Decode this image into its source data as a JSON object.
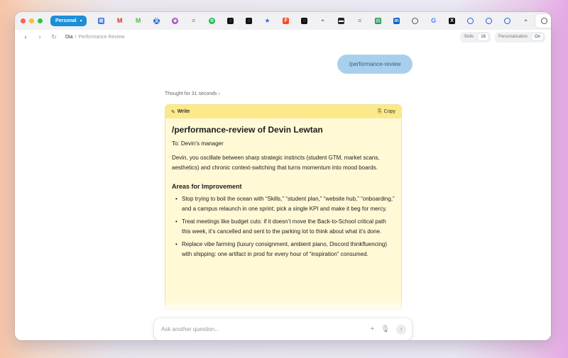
{
  "tabbar": {
    "profile_label": "Personal",
    "tabs": [
      {
        "icon": "calendar-icon",
        "color": "#3b73d9"
      },
      {
        "icon": "gmail-icon",
        "color": "#d93025"
      },
      {
        "icon": "miro-icon",
        "color": "#58b94a"
      },
      {
        "icon": "translate-icon",
        "color": "#2d6fd8"
      },
      {
        "icon": "chrome-icon",
        "color": "#a544c9"
      },
      {
        "icon": "linear-icon",
        "color": "#8b8b8b"
      },
      {
        "icon": "spotify-icon",
        "color": "#1db954"
      },
      {
        "icon": "chatgpt-icon",
        "color": "#111111"
      },
      {
        "icon": "chatgpt-icon",
        "color": "#111111"
      },
      {
        "icon": "star-icon",
        "color": "#3a6ad8"
      },
      {
        "icon": "figma-icon",
        "color": "#f24e1e"
      },
      {
        "icon": "chatgpt-icon",
        "color": "#111111"
      },
      {
        "icon": "game-icon",
        "color": "#7a7a7a"
      },
      {
        "icon": "terminal-icon",
        "color": "#222222"
      },
      {
        "icon": "linear-icon",
        "color": "#8b8b8b"
      },
      {
        "icon": "sheets-icon",
        "color": "#1f9d55"
      },
      {
        "icon": "linkedin-icon",
        "color": "#0a66c2"
      },
      {
        "icon": "chat-bubble-icon",
        "color": "#555555"
      },
      {
        "icon": "google-icon",
        "color": "#4285f4"
      },
      {
        "icon": "x-icon",
        "color": "#111111"
      },
      {
        "icon": "1password-icon",
        "color": "#1a5fd6"
      },
      {
        "icon": "1password-icon",
        "color": "#1a5fd6"
      },
      {
        "icon": "1password-icon",
        "color": "#1a5fd6"
      },
      {
        "icon": "game-icon",
        "color": "#7a7a7a"
      },
      {
        "icon": "chat-bubble-icon",
        "color": "#555555",
        "active": true
      }
    ],
    "new_tab_label": "+"
  },
  "navbar": {
    "site": "Dia",
    "separator": "/",
    "page": "Performance Review",
    "skills_label": "Skills",
    "skills_count": "16",
    "personalization_label": "Personalization",
    "personalization_value": "On"
  },
  "chat": {
    "user_message": "/performance-review",
    "thought_label": "Thought for 31 seconds",
    "card": {
      "write_label": "Write",
      "copy_label": "Copy",
      "title": "/performance-review of Devin Lewtan",
      "to_line": "To: Devin’s manager",
      "intro": "Devin, you oscillate between sharp strategic instincts (student GTM, market scans, aesthetics) and chronic context-switching that turns momentum into mood boards.",
      "section_title": "Areas for Improvement",
      "items": [
        "Stop trying to boil the ocean with “Skills,” “student plan,” “website hub,” “onboarding,” and a campus relaunch in one sprint; pick a single KPI and make it beg for mercy.",
        "Treat meetings like budget cuts: if it doesn’t move the Back-to-School critical path this week, it’s cancelled and sent to the parking lot to think about what it’s done.",
        "Replace vibe farming (luxury consignment, ambient piano, Discord thinkfluencing) with shipping: one artifact in prod for every hour of “inspiration” consumed."
      ]
    },
    "input_placeholder": "Ask another question..."
  },
  "colors": {
    "accent": "#1c8fd8",
    "user_bubble": "#a8d0ec",
    "card_header": "#fbe98a",
    "card_body": "#fff9d6"
  }
}
